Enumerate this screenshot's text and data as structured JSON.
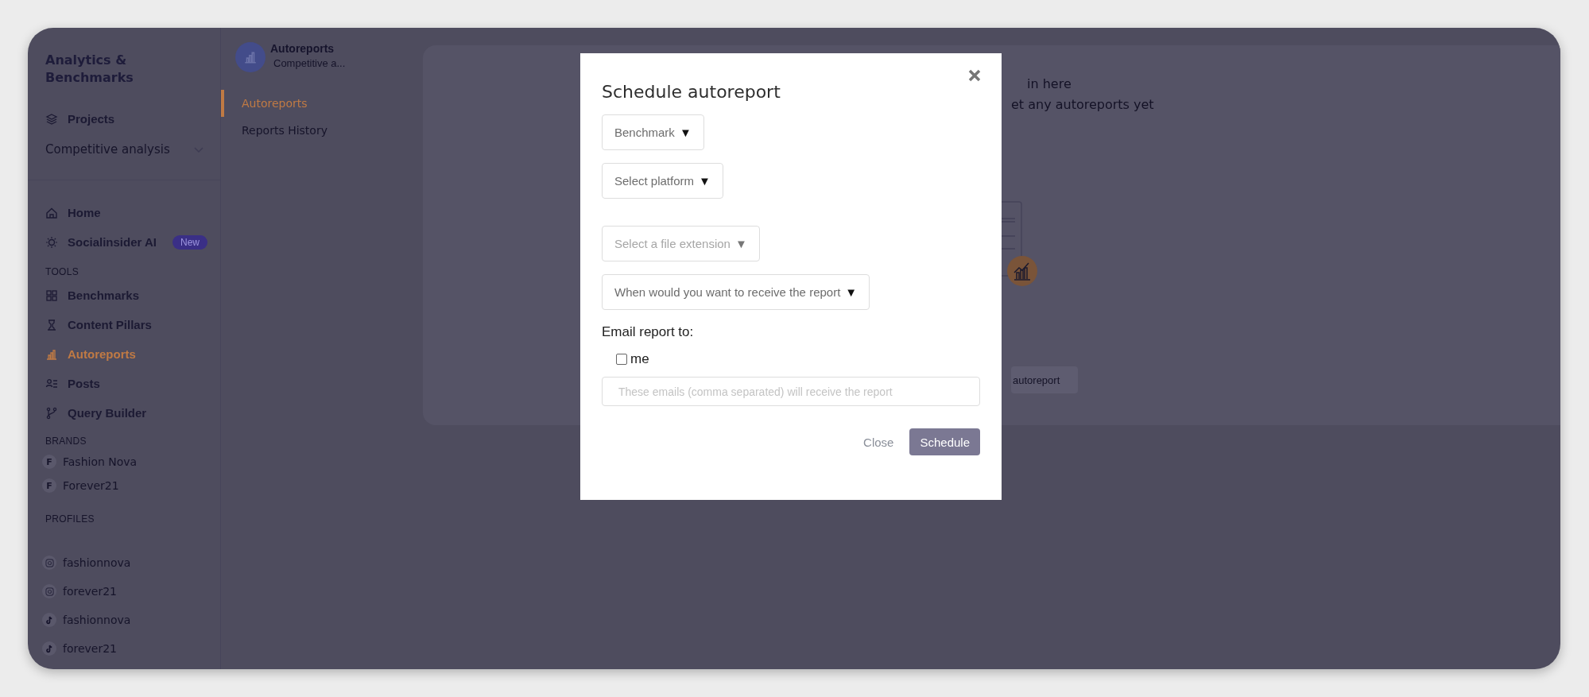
{
  "sidebar": {
    "title": "Analytics & Benchmarks",
    "projects_label": "Projects",
    "project_selector": "Competitive analysis",
    "main_items": [
      {
        "label": "Home",
        "selected": false
      },
      {
        "label": "Socialinsider AI",
        "badge": "New",
        "selected": false
      }
    ],
    "tools_heading": "TOOLS",
    "tools": [
      {
        "label": "Benchmarks",
        "selected": false
      },
      {
        "label": "Content Pillars",
        "selected": false
      },
      {
        "label": "Autoreports",
        "selected": true
      },
      {
        "label": "Posts",
        "selected": false
      },
      {
        "label": "Query Builder",
        "selected": false
      }
    ],
    "brands_heading": "BRANDS",
    "brands": [
      {
        "initial": "F",
        "name": "Fashion Nova"
      },
      {
        "initial": "F",
        "name": "Forever21"
      }
    ],
    "profiles_heading": "PROFILES",
    "profiles": [
      {
        "kind": "instagram",
        "name": "fashionnova"
      },
      {
        "kind": "instagram",
        "name": "forever21"
      },
      {
        "kind": "tiktok",
        "name": "fashionnova"
      },
      {
        "kind": "tiktok",
        "name": "forever21"
      }
    ]
  },
  "subnav": {
    "title": "Autoreports",
    "subtitle": "Competitive a...",
    "items": [
      {
        "label": "Autoreports",
        "selected": true
      },
      {
        "label": "Reports History",
        "selected": false
      }
    ]
  },
  "content": {
    "lines": [
      "in here",
      "et any autoreports yet"
    ],
    "button": "autoreport"
  },
  "modal": {
    "title": "Schedule autoreport",
    "selects": [
      {
        "text": "Benchmark",
        "disabled": false
      },
      {
        "text": "Select platform",
        "disabled": false
      },
      {
        "text": "Select a file extension",
        "disabled": true
      },
      {
        "text": "When would you want to receive the report",
        "disabled": false
      }
    ],
    "arrow": "▼",
    "email_label": "Email report to:",
    "checkbox": {
      "label": "me",
      "checked": false
    },
    "email_field": {
      "placeholder": "These emails (comma separated) will receive the report"
    },
    "buttons": {
      "close": "Close",
      "schedule": "Schedule"
    }
  }
}
